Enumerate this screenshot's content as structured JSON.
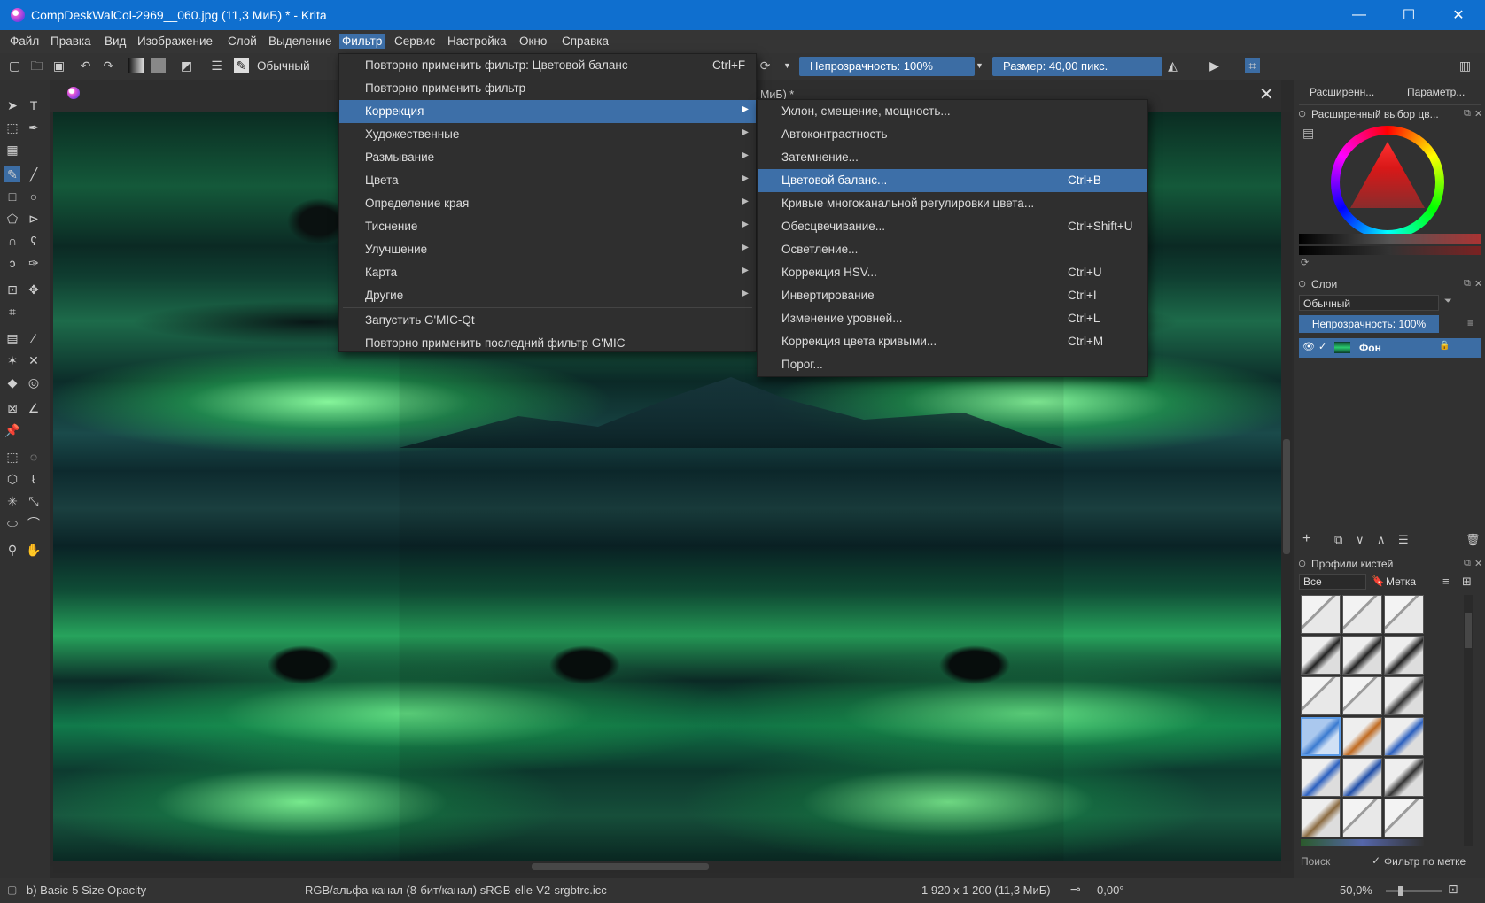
{
  "window": {
    "title": "CompDeskWalCol-2969__060.jpg (11,3 МиБ) * - Krita",
    "controls": [
      "—",
      "☐",
      "✕"
    ]
  },
  "menubar": [
    "Файл",
    "Правка",
    "Вид",
    "Изображение",
    "Слой",
    "Выделение",
    "Фильтр",
    "Сервис",
    "Настройка",
    "Окно",
    "Справка"
  ],
  "toolbar": {
    "blend_mode": "Обычный",
    "opacity": "Непрозрачность: 100%",
    "size": "Размер: 40,00 пикс."
  },
  "document_tab": {
    "title_fragment": "МиБ) *"
  },
  "filter_menu": {
    "items": [
      {
        "label": "Повторно применить фильтр: Цветовой баланс",
        "shortcut": "Ctrl+F"
      },
      {
        "label": "Повторно применить фильтр",
        "shortcut": ""
      },
      {
        "label": "Коррекция",
        "submenu": true
      },
      {
        "label": "Художественные",
        "submenu": true
      },
      {
        "label": "Размывание",
        "submenu": true
      },
      {
        "label": "Цвета",
        "submenu": true
      },
      {
        "label": "Определение края",
        "submenu": true
      },
      {
        "label": "Тиснение",
        "submenu": true
      },
      {
        "label": "Улучшение",
        "submenu": true
      },
      {
        "label": "Карта",
        "submenu": true
      },
      {
        "label": "Другие",
        "submenu": true
      },
      {
        "label": "Запустить G'MIC-Qt",
        "shortcut": ""
      },
      {
        "label": "Повторно применить последний фильтр G'MIC",
        "shortcut": ""
      }
    ],
    "highlighted": "Коррекция"
  },
  "correction_submenu": {
    "items": [
      {
        "label": "Уклон, смещение, мощность...",
        "shortcut": ""
      },
      {
        "label": "Автоконтрастность",
        "shortcut": ""
      },
      {
        "label": "Затемнение...",
        "shortcut": ""
      },
      {
        "label": "Цветовой баланс...",
        "shortcut": "Ctrl+B"
      },
      {
        "label": "Кривые многоканальной регулировки цвета...",
        "shortcut": ""
      },
      {
        "label": "Обесцвечивание...",
        "shortcut": "Ctrl+Shift+U"
      },
      {
        "label": "Осветление...",
        "shortcut": ""
      },
      {
        "label": "Коррекция HSV...",
        "shortcut": "Ctrl+U"
      },
      {
        "label": "Инвертирование",
        "shortcut": "Ctrl+I"
      },
      {
        "label": "Изменение уровней...",
        "shortcut": "Ctrl+L"
      },
      {
        "label": "Коррекция цвета кривыми...",
        "shortcut": "Ctrl+M"
      },
      {
        "label": "Порог...",
        "shortcut": ""
      }
    ],
    "highlighted": "Цветовой баланс..."
  },
  "docker": {
    "tabs": [
      "Расширенн...",
      "Параметр..."
    ],
    "color_selector_title": "Расширенный выбор цв...",
    "layers_title": "Слои",
    "layers_blend": "Обычный",
    "layers_opacity": "Непрозрачность: 100%",
    "layer_name": "Фон",
    "brush_title": "Профили кистей",
    "brush_filter": "Все",
    "brush_tag": "Метка",
    "search_label": "Поиск",
    "filter_by_tag": "Фильтр по метке"
  },
  "statusbar": {
    "brush": "b) Basic-5 Size Opacity",
    "colorspace": "RGB/альфа-канал (8-бит/канал)  sRGB-elle-V2-srgbtrc.icc",
    "dimensions": "1 920 x 1 200 (11,3 МиБ)",
    "rotation": "0,00°",
    "zoom": "50,0%"
  },
  "colors": {
    "accent": "#3d6fa8",
    "titlebar": "#0f6fcf",
    "panel": "#313131"
  }
}
